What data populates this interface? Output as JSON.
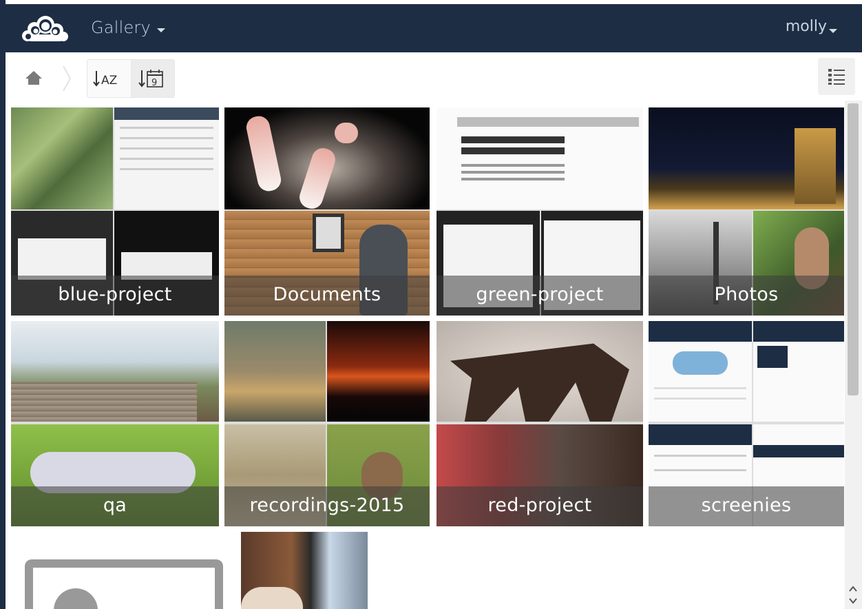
{
  "header": {
    "app_name": "Gallery",
    "user_name": "molly",
    "logo_icon": "owncloud-logo-icon"
  },
  "toolbar": {
    "home_icon": "home-icon",
    "sort_name_label": "AZ",
    "sort_date_label": "9",
    "view_icon": "list-view-icon"
  },
  "albums": [
    {
      "name": "blue-project"
    },
    {
      "name": "Documents"
    },
    {
      "name": "green-project"
    },
    {
      "name": "Photos"
    },
    {
      "name": "qa"
    },
    {
      "name": "recordings-2015"
    },
    {
      "name": "red-project"
    },
    {
      "name": "screenies"
    }
  ],
  "colors": {
    "header_bg": "#1d2d44",
    "label_overlay": "rgba(60,60,60,0.55)"
  }
}
